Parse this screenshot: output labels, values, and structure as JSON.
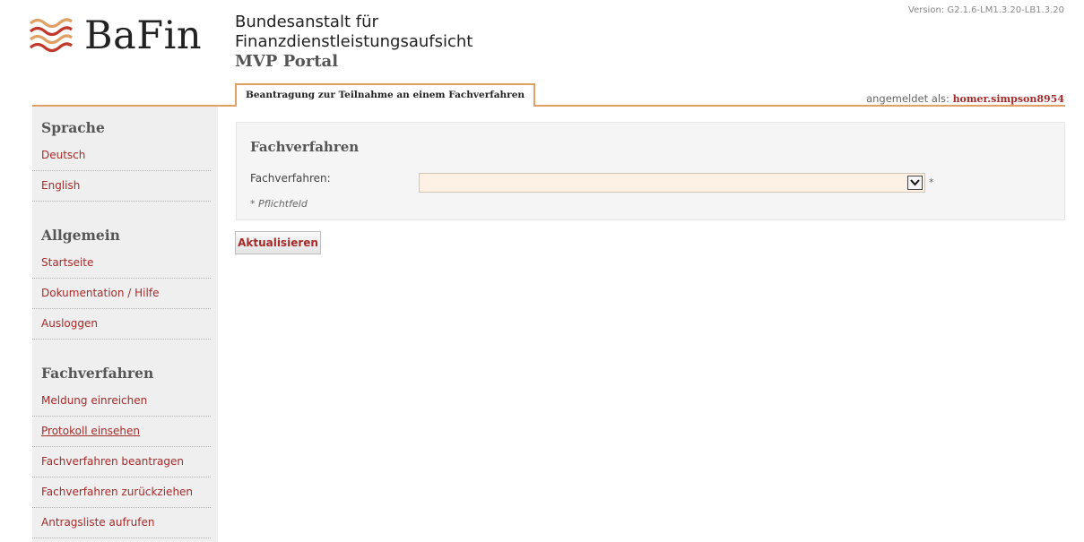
{
  "header": {
    "logo_text": "BaFin",
    "org_line1": "Bundesanstalt für",
    "org_line2": "Finanzdienstleistungsaufsicht",
    "portal": "MVP Portal",
    "version": "Version: G2.1.6-LM1.3.20-LB1.3.20"
  },
  "tab": {
    "label": "Beantragung zur Teilnahme an einem Fachverfahren"
  },
  "user": {
    "label": "angemeldet als:",
    "name": "homer.simpson8954"
  },
  "sidebar": {
    "sections": [
      {
        "title": "Sprache",
        "items": [
          "Deutsch",
          "English"
        ]
      },
      {
        "title": "Allgemein",
        "items": [
          "Startseite",
          "Dokumentation / Hilfe",
          "Ausloggen"
        ]
      },
      {
        "title": "Fachverfahren",
        "items": [
          "Meldung einreichen",
          "Protokoll einsehen",
          "Fachverfahren beantragen",
          "Fachverfahren zurückziehen",
          "Antragsliste aufrufen"
        ]
      }
    ]
  },
  "form": {
    "title": "Fachverfahren",
    "field_label": "Fachverfahren:",
    "selected_value": "",
    "required_mark": "*",
    "required_note": "* Pflichtfeld",
    "submit_label": "Aktualisieren"
  },
  "colors": {
    "accent": "#e0a064",
    "link": "#a52a2a",
    "sidebar_bg": "#efefef"
  }
}
